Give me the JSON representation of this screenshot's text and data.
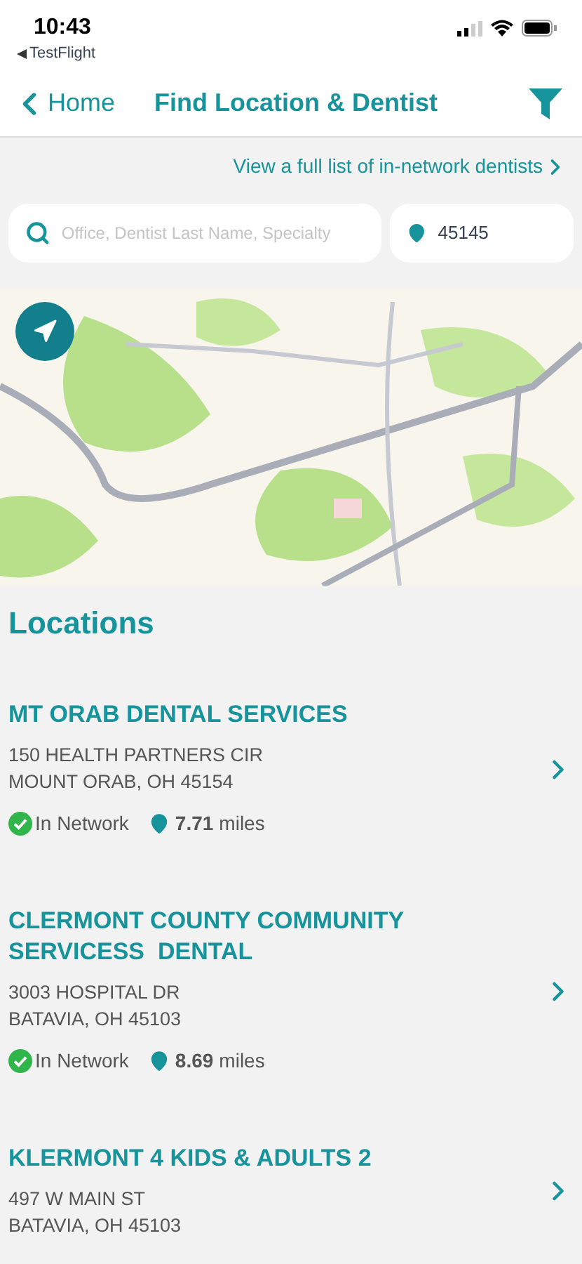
{
  "status_bar": {
    "time": "10:43",
    "back_app": "TestFlight"
  },
  "nav": {
    "back": "Home",
    "title": "Find Location & Dentist"
  },
  "network_link": "View a full list of in-network dentists",
  "search": {
    "placeholder": "Office, Dentist Last Name, Specialty"
  },
  "zip": {
    "value": "45145"
  },
  "section_title": "Locations",
  "locations": [
    {
      "name": "MT ORAB DENTAL SERVICES",
      "address": [
        "150 HEALTH PARTNERS CIR",
        "MOUNT ORAB, OH 45154"
      ],
      "network": "In Network",
      "in_network": true,
      "distance": "7.71",
      "unit": "miles"
    },
    {
      "name": "CLERMONT COUNTY COMMUNITY SERVICESS  DENTAL",
      "address": [
        "3003 HOSPITAL DR",
        "BATAVIA, OH 45103"
      ],
      "network": "In Network",
      "in_network": true,
      "distance": "8.69",
      "unit": "miles"
    },
    {
      "name": "KLERMONT 4 KIDS & ADULTS 2",
      "address": [
        "497 W MAIN ST",
        "BATAVIA, OH 45103"
      ]
    }
  ]
}
